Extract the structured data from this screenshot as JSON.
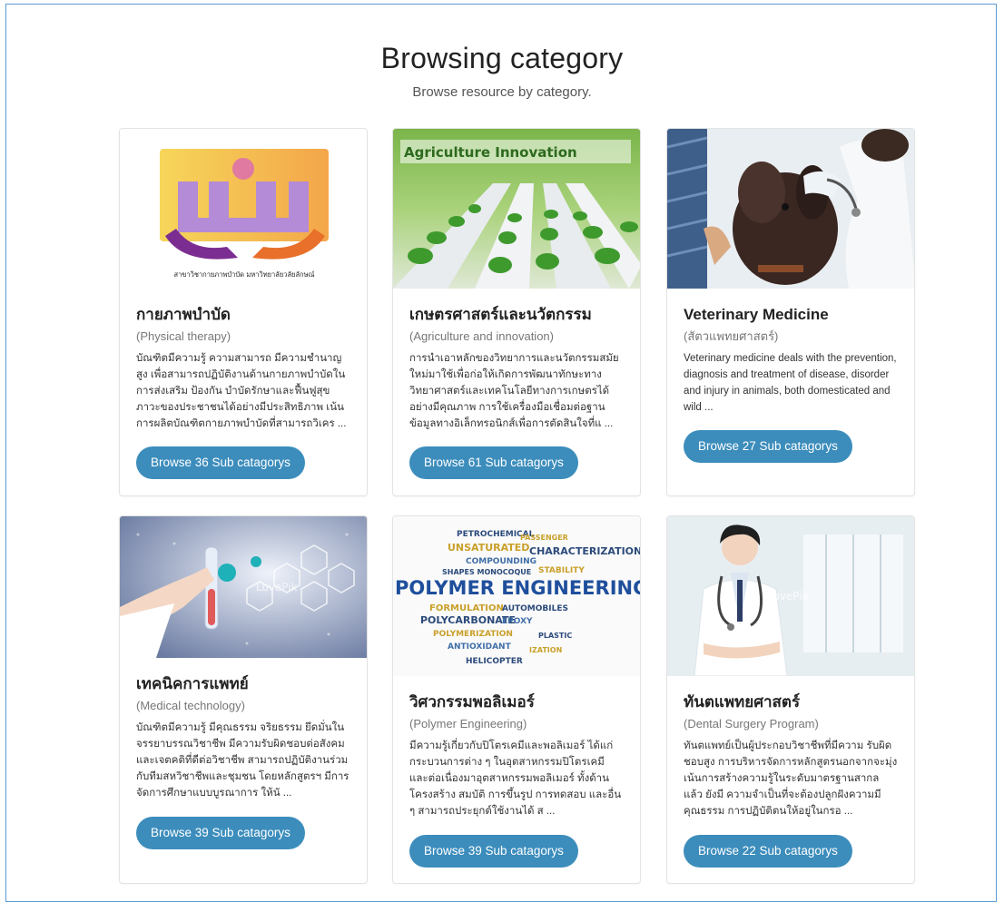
{
  "page": {
    "title": "Browsing category",
    "subtitle": "Browse resource by category."
  },
  "categories": [
    {
      "title": "กายภาพบำบัด",
      "subtitle": "(Physical therapy)",
      "description": "บัณฑิตมีความรู้ ความสามารถ มีความชำนาญสูง เพื่อสามารถปฏิบัติงานด้านกายภาพบำบัดในการส่งเสริม ป้องกัน บำบัดรักษาและฟื้นฟูสุขภาวะของประชาชนได้อย่างมีประสิทธิภาพ เน้นการผลิตบัณฑิตกายภาพบำบัดที่สามารถวิเคร ...",
      "button": "Browse 36 Sub catagorys",
      "image_caption": "สาขาวิชากายภาพบำบัด มหาวิทยาลัยวลัยลักษณ์"
    },
    {
      "title": "เกษตรศาสตร์และนวัตกรรม",
      "subtitle": "(Agriculture and innovation)",
      "description": "การนำเอาหลักของวิทยาการและนวัตกรรมสมัยใหม่มาใช้เพื่อก่อให้เกิดการพัฒนาทักษะทางวิทยาศาสตร์และเทคโนโลยีทางการเกษตรได้อย่างมีคุณภาพ การใช้เครื่องมือเชื่อมต่อฐานข้อมูลทางอิเล็กทรอนิกส์เพื่อการตัดสินใจที่แ ...",
      "button": "Browse 61 Sub catagorys",
      "image_caption": "Agriculture Innovation"
    },
    {
      "title": "Veterinary Medicine",
      "subtitle": "(สัตวแพทยศาสตร์)",
      "description": "Veterinary medicine deals with the prevention, diagnosis and treatment of disease, disorder and injury in animals, both domesticated and wild ...",
      "button": "Browse 27 Sub catagorys"
    },
    {
      "title": "เทคนิคการแพทย์",
      "subtitle": "(Medical technology)",
      "description": "บัณฑิตมีความรู้ มีคุณธรรม จริยธรรม ยึดมั่นในจรรยาบรรณวิชาชีพ มีความรับผิดชอบต่อสังคม และเจตคติที่ดีต่อวิชาชีพ สามารถปฏิบัติงานร่วมกับทีมสหวิชาชีพและชุมชน โดยหลักสูตรฯ มีการจัดการศึกษาแบบบูรณาการ ให้นั ...",
      "button": "Browse 39 Sub catagorys",
      "image_caption": "LovePik"
    },
    {
      "title": "วิศวกรรมพอลิเมอร์",
      "subtitle": "(Polymer Engineering)",
      "description": "มีความรู้เกี่ยวกับปิโตรเคมีและพอลิเมอร์ ได้แก่ กระบวนการต่าง ๆ ในอุตสาหกรรมปิโตรเคมี และต่อเนื่องมาอุตสาหกรรมพอลิเมอร์ ทั้งด้านโครงสร้าง สมบัติ การขึ้นรูป การทดสอบ และอื่น ๆ สามารถประยุกต์ใช้งานได้ ส ...",
      "button": "Browse 39 Sub catagorys",
      "image_caption": "POLYMER ENGINEERING"
    },
    {
      "title": "ทันตแพทยศาสตร์",
      "subtitle": "(Dental Surgery Program)",
      "description": "ทันตแพทย์เป็นผู้ประกอบวิชาชีพที่มีความ รับผิดชอบสูง การบริหารจัดการหลักสูตรนอกจากจะมุ่งเน้นการสร้างความรู้ในระดับมาตรฐานสากลแล้ว ยังมี ความจำเป็นที่จะต้องปลูกฝังความมีคุณธรรม การปฏิบัติตนให้อยู่ในกรอ ...",
      "button": "Browse 22 Sub catagorys",
      "image_caption": "LovePik"
    }
  ],
  "colors": {
    "button": "#3c8dbc",
    "frame_border": "#5b9bd5"
  }
}
